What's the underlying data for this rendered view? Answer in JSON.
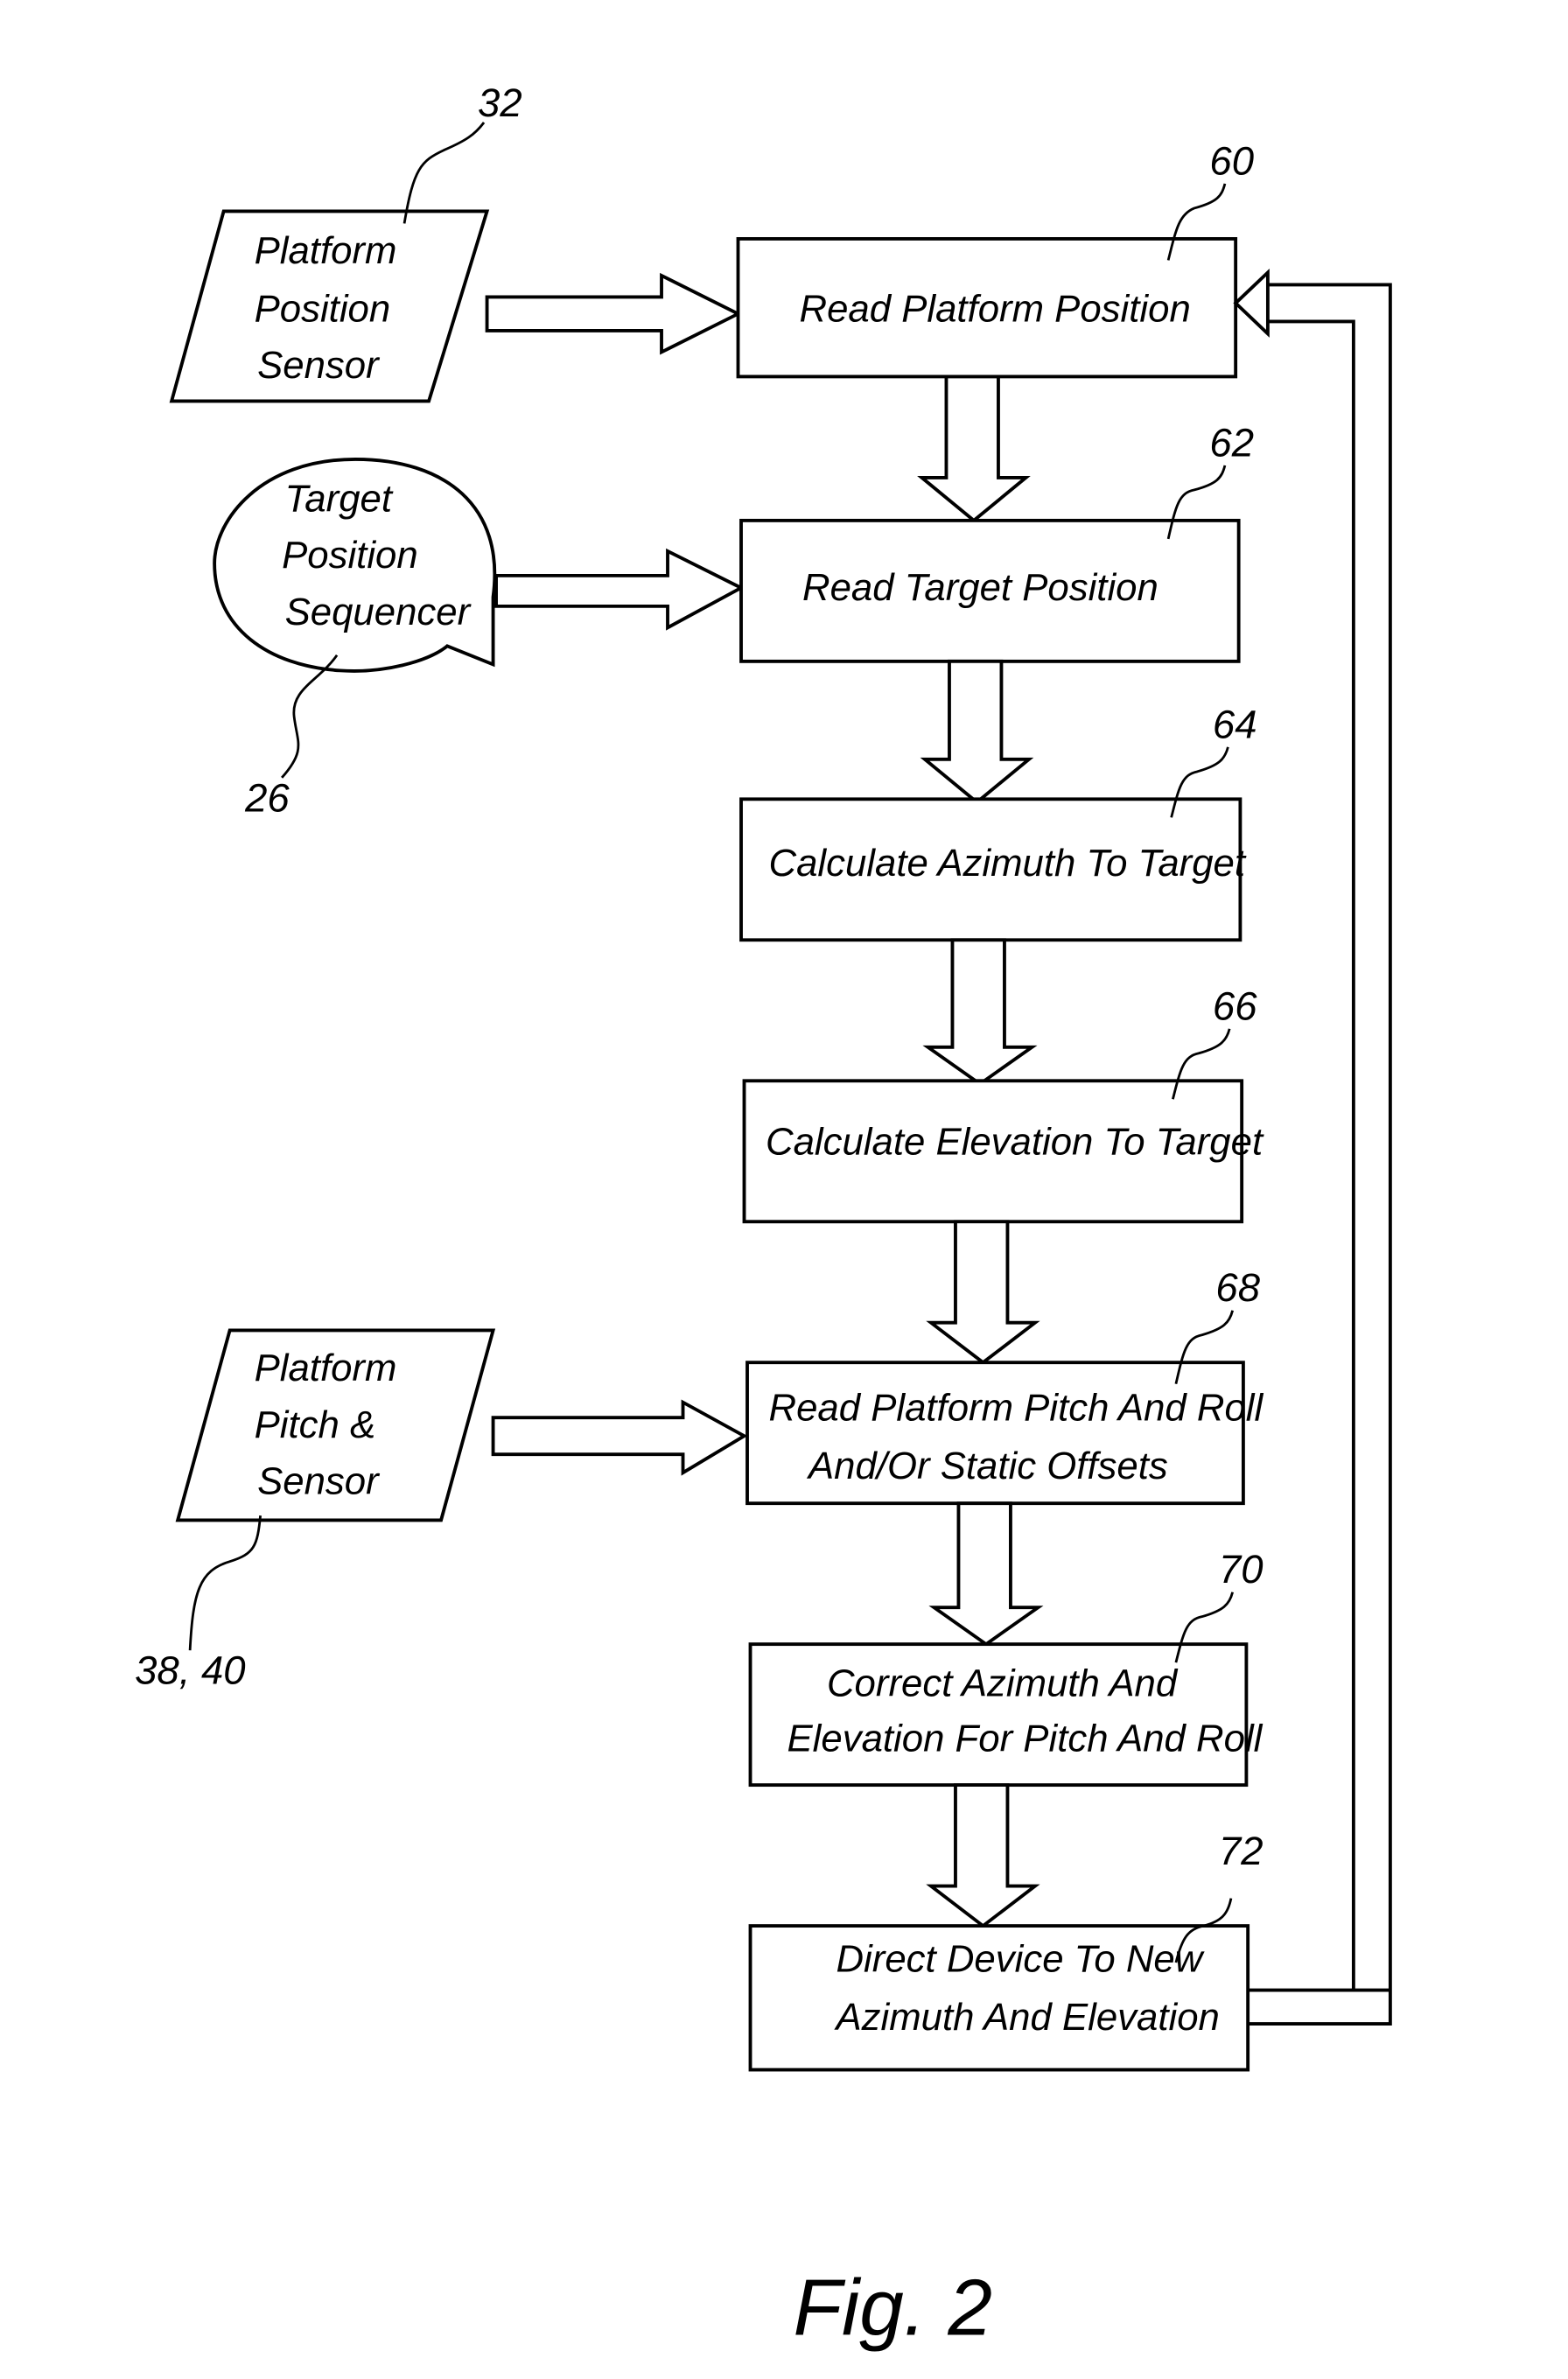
{
  "figure": {
    "caption": "Fig. 2",
    "inputs": [
      {
        "id": "platform-position-sensor",
        "ref": "32",
        "lines": [
          "Platform",
          "Position",
          "Sensor"
        ],
        "shape": "parallelogram",
        "feeds": "60"
      },
      {
        "id": "target-position-sequencer",
        "ref": "26",
        "lines": [
          "Target",
          "Position",
          "Sequencer"
        ],
        "shape": "oval-callout",
        "feeds": "62"
      },
      {
        "id": "platform-pitch-sensor",
        "ref": "38, 40",
        "lines": [
          "Platform",
          "Pitch &",
          "Sensor"
        ],
        "shape": "parallelogram",
        "feeds": "68"
      }
    ],
    "steps": [
      {
        "ref": "60",
        "lines": [
          "Read Platform Position"
        ]
      },
      {
        "ref": "62",
        "lines": [
          "Read Target Position"
        ]
      },
      {
        "ref": "64",
        "lines": [
          "Calculate Azimuth To Target"
        ]
      },
      {
        "ref": "66",
        "lines": [
          "Calculate Elevation To Target"
        ]
      },
      {
        "ref": "68",
        "lines": [
          "Read Platform Pitch And Roll",
          "And/Or Static Offsets"
        ]
      },
      {
        "ref": "70",
        "lines": [
          "Correct Azimuth And",
          "Elevation For Pitch And Roll"
        ]
      },
      {
        "ref": "72",
        "lines": [
          "Direct Device To New",
          "Azimuth And Elevation"
        ]
      }
    ],
    "loop": {
      "from": "72",
      "to": "60"
    }
  }
}
